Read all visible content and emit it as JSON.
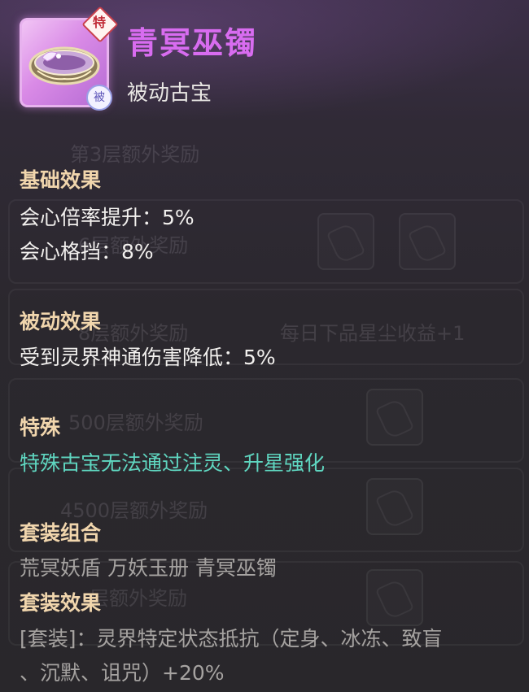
{
  "item": {
    "name": "青冥巫镯",
    "type": "被动古宝",
    "tag_top": "特",
    "tag_bottom": "被"
  },
  "background_list": {
    "rows": [
      "第3层额外奖励",
      "6层额外奖励",
      "8层额外奖励",
      "每日下品星尘收益+1",
      "500层额外奖励",
      "4500层额外奖励",
      "层额外奖励"
    ]
  },
  "sections": {
    "basic": {
      "title": "基础效果",
      "lines": [
        "会心倍率提升：5%",
        "会心格挡：8%"
      ]
    },
    "passive": {
      "title": "被动效果",
      "lines": [
        "受到灵界神通伤害降低：5%"
      ]
    },
    "special": {
      "title": "特殊",
      "lines": [
        "特殊古宝无法通过注灵、升星强化"
      ]
    },
    "set_combo": {
      "title": "套装组合",
      "lines": [
        "荒冥妖盾 万妖玉册 青冥巫镯"
      ]
    },
    "set_effect": {
      "title": "套装效果",
      "lines": [
        "[套装]：灵界特定状态抵抗（定身、冰冻、致盲",
        "、沉默、诅咒）+20%"
      ]
    }
  },
  "colors": {
    "name": "#d86cf0",
    "section_title": "#f1d6ad",
    "special_text": "#5fd6c0",
    "set_text": "#a6a3a1"
  }
}
